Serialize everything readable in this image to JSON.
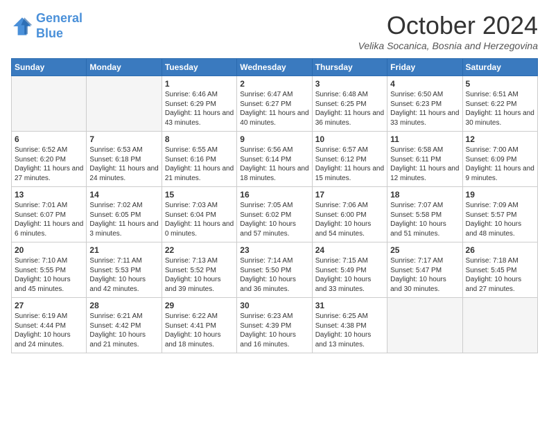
{
  "header": {
    "logo_line1": "General",
    "logo_line2": "Blue",
    "month_title": "October 2024",
    "location": "Velika Socanica, Bosnia and Herzegovina"
  },
  "weekdays": [
    "Sunday",
    "Monday",
    "Tuesday",
    "Wednesday",
    "Thursday",
    "Friday",
    "Saturday"
  ],
  "weeks": [
    [
      {
        "day": "",
        "empty": true
      },
      {
        "day": "",
        "empty": true
      },
      {
        "day": "1",
        "sunrise": "6:46 AM",
        "sunset": "6:29 PM",
        "daylight": "11 hours and 43 minutes."
      },
      {
        "day": "2",
        "sunrise": "6:47 AM",
        "sunset": "6:27 PM",
        "daylight": "11 hours and 40 minutes."
      },
      {
        "day": "3",
        "sunrise": "6:48 AM",
        "sunset": "6:25 PM",
        "daylight": "11 hours and 36 minutes."
      },
      {
        "day": "4",
        "sunrise": "6:50 AM",
        "sunset": "6:23 PM",
        "daylight": "11 hours and 33 minutes."
      },
      {
        "day": "5",
        "sunrise": "6:51 AM",
        "sunset": "6:22 PM",
        "daylight": "11 hours and 30 minutes."
      }
    ],
    [
      {
        "day": "6",
        "sunrise": "6:52 AM",
        "sunset": "6:20 PM",
        "daylight": "11 hours and 27 minutes."
      },
      {
        "day": "7",
        "sunrise": "6:53 AM",
        "sunset": "6:18 PM",
        "daylight": "11 hours and 24 minutes."
      },
      {
        "day": "8",
        "sunrise": "6:55 AM",
        "sunset": "6:16 PM",
        "daylight": "11 hours and 21 minutes."
      },
      {
        "day": "9",
        "sunrise": "6:56 AM",
        "sunset": "6:14 PM",
        "daylight": "11 hours and 18 minutes."
      },
      {
        "day": "10",
        "sunrise": "6:57 AM",
        "sunset": "6:12 PM",
        "daylight": "11 hours and 15 minutes."
      },
      {
        "day": "11",
        "sunrise": "6:58 AM",
        "sunset": "6:11 PM",
        "daylight": "11 hours and 12 minutes."
      },
      {
        "day": "12",
        "sunrise": "7:00 AM",
        "sunset": "6:09 PM",
        "daylight": "11 hours and 9 minutes."
      }
    ],
    [
      {
        "day": "13",
        "sunrise": "7:01 AM",
        "sunset": "6:07 PM",
        "daylight": "11 hours and 6 minutes."
      },
      {
        "day": "14",
        "sunrise": "7:02 AM",
        "sunset": "6:05 PM",
        "daylight": "11 hours and 3 minutes."
      },
      {
        "day": "15",
        "sunrise": "7:03 AM",
        "sunset": "6:04 PM",
        "daylight": "11 hours and 0 minutes."
      },
      {
        "day": "16",
        "sunrise": "7:05 AM",
        "sunset": "6:02 PM",
        "daylight": "10 hours and 57 minutes."
      },
      {
        "day": "17",
        "sunrise": "7:06 AM",
        "sunset": "6:00 PM",
        "daylight": "10 hours and 54 minutes."
      },
      {
        "day": "18",
        "sunrise": "7:07 AM",
        "sunset": "5:58 PM",
        "daylight": "10 hours and 51 minutes."
      },
      {
        "day": "19",
        "sunrise": "7:09 AM",
        "sunset": "5:57 PM",
        "daylight": "10 hours and 48 minutes."
      }
    ],
    [
      {
        "day": "20",
        "sunrise": "7:10 AM",
        "sunset": "5:55 PM",
        "daylight": "10 hours and 45 minutes."
      },
      {
        "day": "21",
        "sunrise": "7:11 AM",
        "sunset": "5:53 PM",
        "daylight": "10 hours and 42 minutes."
      },
      {
        "day": "22",
        "sunrise": "7:13 AM",
        "sunset": "5:52 PM",
        "daylight": "10 hours and 39 minutes."
      },
      {
        "day": "23",
        "sunrise": "7:14 AM",
        "sunset": "5:50 PM",
        "daylight": "10 hours and 36 minutes."
      },
      {
        "day": "24",
        "sunrise": "7:15 AM",
        "sunset": "5:49 PM",
        "daylight": "10 hours and 33 minutes."
      },
      {
        "day": "25",
        "sunrise": "7:17 AM",
        "sunset": "5:47 PM",
        "daylight": "10 hours and 30 minutes."
      },
      {
        "day": "26",
        "sunrise": "7:18 AM",
        "sunset": "5:45 PM",
        "daylight": "10 hours and 27 minutes."
      }
    ],
    [
      {
        "day": "27",
        "sunrise": "6:19 AM",
        "sunset": "4:44 PM",
        "daylight": "10 hours and 24 minutes."
      },
      {
        "day": "28",
        "sunrise": "6:21 AM",
        "sunset": "4:42 PM",
        "daylight": "10 hours and 21 minutes."
      },
      {
        "day": "29",
        "sunrise": "6:22 AM",
        "sunset": "4:41 PM",
        "daylight": "10 hours and 18 minutes."
      },
      {
        "day": "30",
        "sunrise": "6:23 AM",
        "sunset": "4:39 PM",
        "daylight": "10 hours and 16 minutes."
      },
      {
        "day": "31",
        "sunrise": "6:25 AM",
        "sunset": "4:38 PM",
        "daylight": "10 hours and 13 minutes."
      },
      {
        "day": "",
        "empty": true
      },
      {
        "day": "",
        "empty": true
      }
    ]
  ]
}
